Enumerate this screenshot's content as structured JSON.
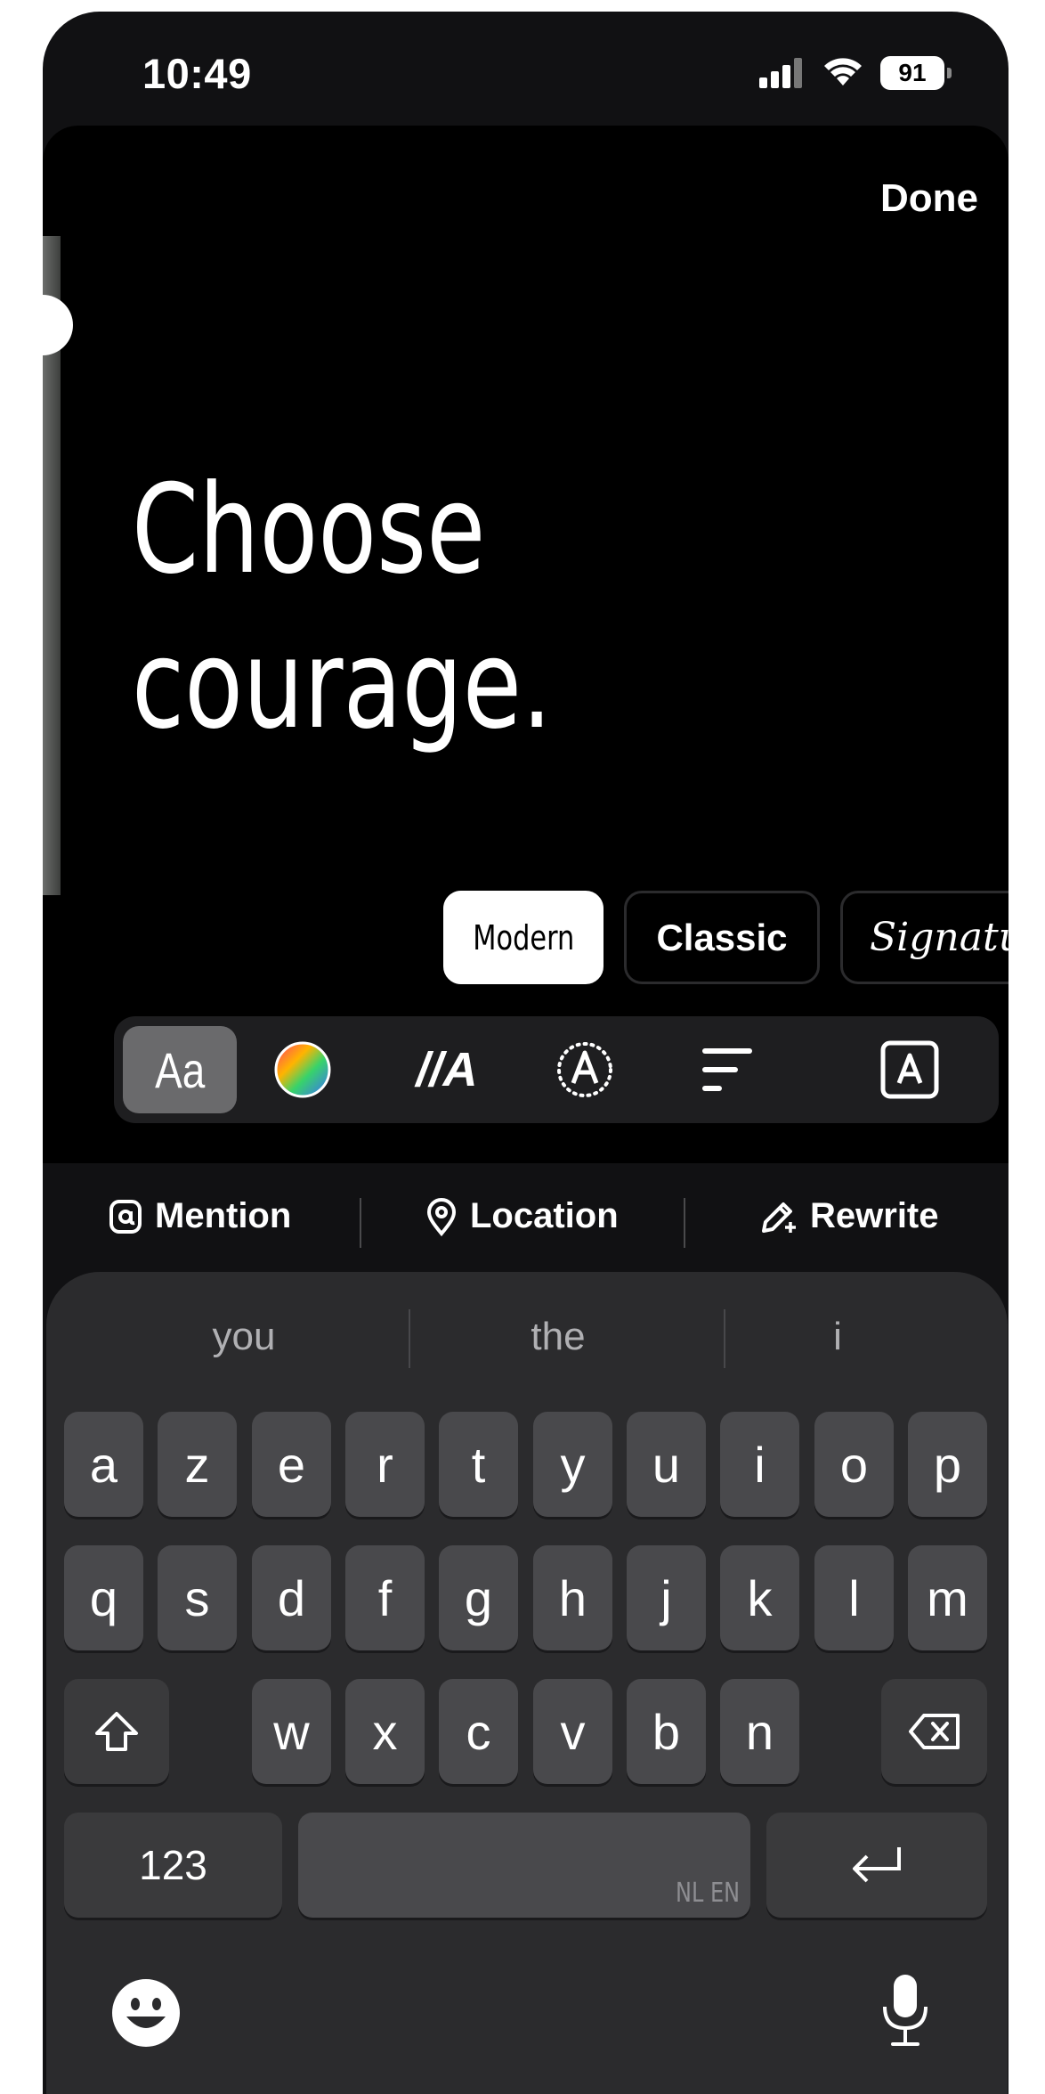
{
  "status": {
    "time": "10:49",
    "battery": "91"
  },
  "editor": {
    "done_label": "Done",
    "story_text": "Choose\ncourage.",
    "fonts": [
      {
        "label": "Modern",
        "active": true
      },
      {
        "label": "Classic",
        "active": false
      },
      {
        "label": "Signatu",
        "active": false
      }
    ],
    "tools": [
      {
        "name": "font",
        "label": "Aa",
        "active": true
      },
      {
        "name": "color",
        "active": false
      },
      {
        "name": "animate",
        "label": "//A",
        "active": false
      },
      {
        "name": "effect",
        "active": false
      },
      {
        "name": "align",
        "active": false
      },
      {
        "name": "background",
        "label": "A",
        "active": false
      }
    ]
  },
  "quick_actions": {
    "mention": "Mention",
    "location": "Location",
    "rewrite": "Rewrite"
  },
  "keyboard": {
    "suggestions": [
      "you",
      "the",
      "i"
    ],
    "row1": [
      "a",
      "z",
      "e",
      "r",
      "t",
      "y",
      "u",
      "i",
      "o",
      "p"
    ],
    "row2": [
      "q",
      "s",
      "d",
      "f",
      "g",
      "h",
      "j",
      "k",
      "l",
      "m"
    ],
    "row3": [
      "w",
      "x",
      "c",
      "v",
      "b",
      "n"
    ],
    "numbers_label": "123",
    "space_languages": "NL EN"
  }
}
